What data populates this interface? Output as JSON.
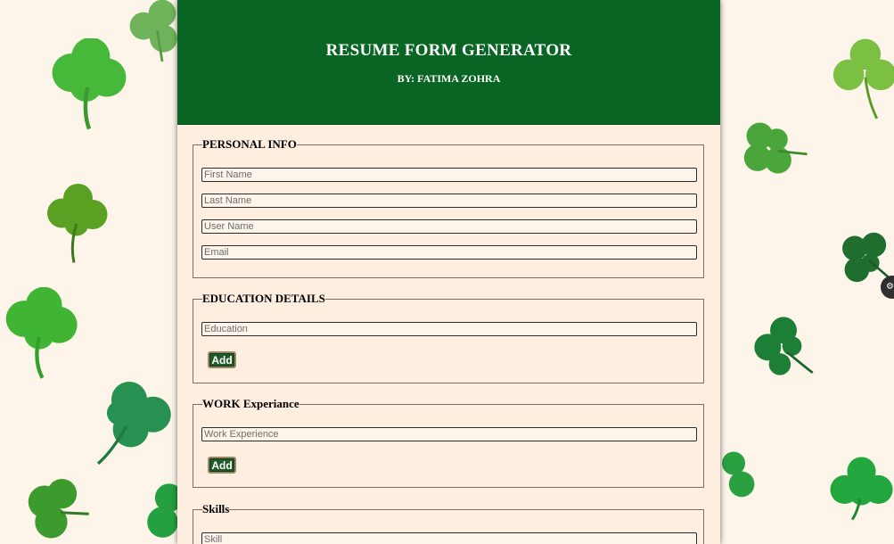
{
  "header": {
    "title": "RESUME FORM GENERATOR",
    "byline": "BY: FATIMA ZOHRA"
  },
  "sections": {
    "personal": {
      "legend": "PERSONAL INFO",
      "first_name_placeholder": "First Name",
      "last_name_placeholder": "Last Name",
      "user_name_placeholder": "User Name",
      "email_placeholder": "Email"
    },
    "education": {
      "legend": "EDUCATION DETAILS",
      "placeholder": "Education",
      "add_label": "Add"
    },
    "work": {
      "legend": "WORK Experiance",
      "placeholder": "Work Experience",
      "add_label": "Add"
    },
    "skills": {
      "legend": "Skills",
      "placeholder": "Skill"
    }
  },
  "colors": {
    "header_bg": "#096523",
    "page_bg": "#fdf4ea",
    "form_bg": "#fdeedf",
    "button_bg": "#1f5a29"
  },
  "icons": {
    "decoration": "shamrock-clover-icon",
    "side_widget": "gear-icon"
  }
}
